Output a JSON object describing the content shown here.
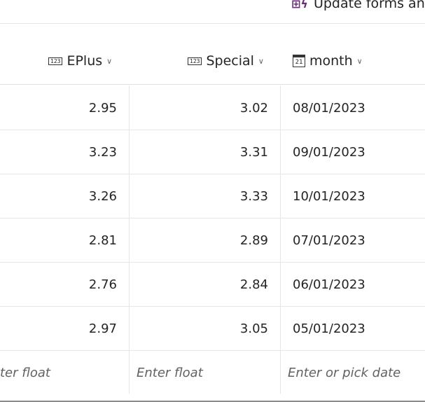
{
  "toolbar": {
    "update_label": "Update forms an",
    "update_icon": "form-lightning-icon"
  },
  "columns": [
    {
      "label": "EPlus",
      "icon": "number-icon"
    },
    {
      "label": "Special",
      "icon": "number-icon"
    },
    {
      "label": "month",
      "icon": "calendar-icon"
    }
  ],
  "rows": [
    {
      "eplus": "2.95",
      "special": "3.02",
      "month": "08/01/2023"
    },
    {
      "eplus": "3.23",
      "special": "3.31",
      "month": "09/01/2023"
    },
    {
      "eplus": "3.26",
      "special": "3.33",
      "month": "10/01/2023"
    },
    {
      "eplus": "2.81",
      "special": "2.89",
      "month": "07/01/2023"
    },
    {
      "eplus": "2.76",
      "special": "2.84",
      "month": "06/01/2023"
    },
    {
      "eplus": "2.97",
      "special": "3.05",
      "month": "05/01/2023"
    }
  ],
  "new_row": {
    "eplus_placeholder": "ter float",
    "special_placeholder": "Enter float",
    "month_placeholder": "Enter or pick date"
  },
  "icons": {
    "number": "123",
    "calendar": "21",
    "chevron": "∨"
  }
}
